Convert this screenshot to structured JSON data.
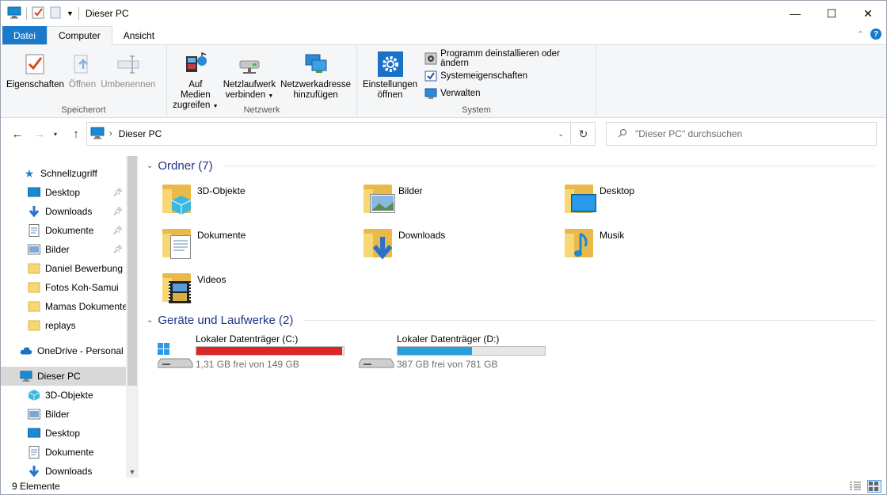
{
  "window": {
    "title": "Dieser PC",
    "controls": {
      "minimize": "—",
      "maximize": "☐",
      "close": "✕"
    }
  },
  "ribbon": {
    "tabs": [
      {
        "label": "Datei"
      },
      {
        "label": "Computer"
      },
      {
        "label": "Ansicht"
      }
    ],
    "help": "?",
    "groups": {
      "speicherort": {
        "label": "Speicherort",
        "buttons": [
          {
            "label": "Eigenschaften",
            "icon": "properties-icon",
            "enabled": true
          },
          {
            "label": "Öffnen",
            "icon": "open-icon",
            "enabled": false
          },
          {
            "label": "Umbenennen",
            "icon": "rename-icon",
            "enabled": false
          }
        ]
      },
      "netzwerk": {
        "label": "Netzwerk",
        "buttons": [
          {
            "line1": "Auf Medien",
            "line2": "zugreifen",
            "icon": "media-access-icon"
          },
          {
            "line1": "Netzlaufwerk",
            "line2": "verbinden",
            "icon": "map-network-drive-icon"
          },
          {
            "line1": "Netzwerkadresse",
            "line2": "hinzufügen",
            "icon": "add-network-location-icon"
          }
        ]
      },
      "system": {
        "label": "System",
        "big": {
          "line1": "Einstellungen",
          "line2": "öffnen",
          "icon": "settings-icon"
        },
        "small": [
          {
            "label": "Programm deinstallieren oder ändern",
            "icon": "uninstall-icon"
          },
          {
            "label": "Systemeigenschaften",
            "icon": "system-properties-icon"
          },
          {
            "label": "Verwalten",
            "icon": "manage-icon"
          }
        ]
      }
    }
  },
  "addressbar": {
    "path": "Dieser PC",
    "search_placeholder": "\"Dieser PC\" durchsuchen"
  },
  "sidebar": {
    "quick_access": "Schnellzugriff",
    "items": [
      {
        "label": "Desktop",
        "pinned": true
      },
      {
        "label": "Downloads",
        "pinned": true
      },
      {
        "label": "Dokumente",
        "pinned": true
      },
      {
        "label": "Bilder",
        "pinned": true
      },
      {
        "label": "Daniel Bewerbung",
        "pinned": false
      },
      {
        "label": "Fotos Koh-Samui",
        "pinned": false
      },
      {
        "label": "Mamas Dokumente",
        "pinned": false
      },
      {
        "label": "replays",
        "pinned": false
      }
    ],
    "onedrive": "OneDrive - Personal",
    "this_pc": "Dieser PC",
    "pc_items": [
      {
        "label": "3D-Objekte"
      },
      {
        "label": "Bilder"
      },
      {
        "label": "Desktop"
      },
      {
        "label": "Dokumente"
      },
      {
        "label": "Downloads"
      }
    ]
  },
  "content": {
    "folders_header": "Ordner (7)",
    "folders": [
      {
        "name": "3D-Objekte",
        "icon": "3d-objects-folder-icon"
      },
      {
        "name": "Bilder",
        "icon": "pictures-folder-icon"
      },
      {
        "name": "Desktop",
        "icon": "desktop-folder-icon"
      },
      {
        "name": "Dokumente",
        "icon": "documents-folder-icon"
      },
      {
        "name": "Downloads",
        "icon": "downloads-folder-icon"
      },
      {
        "name": "Musik",
        "icon": "music-folder-icon"
      },
      {
        "name": "Videos",
        "icon": "videos-folder-icon"
      }
    ],
    "drives_header": "Geräte und Laufwerke (2)",
    "drives": [
      {
        "name": "Lokaler Datenträger (C:)",
        "free": "1,31 GB frei von 149 GB",
        "used_fraction": 0.991,
        "bar_color": "#da2626"
      },
      {
        "name": "Lokaler Datenträger (D:)",
        "free": "387 GB frei von 781 GB",
        "used_fraction": 0.505,
        "bar_color": "#26a0da"
      }
    ]
  },
  "statusbar": {
    "count": "9 Elemente"
  }
}
